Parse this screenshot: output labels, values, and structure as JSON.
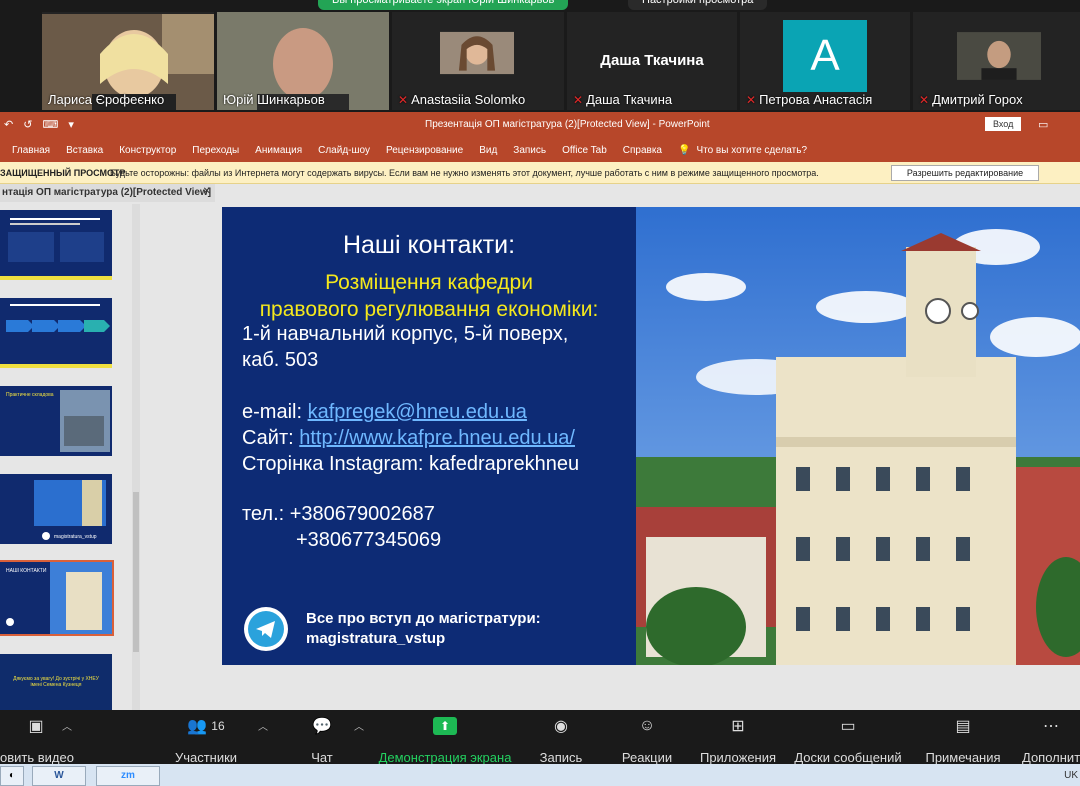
{
  "share_banner": {
    "sharing_label": "Вы просматриваете экран Юрій Шинкарьов",
    "view_options_label": "Настройки просмотра"
  },
  "participants": [
    {
      "name": "Лариса Єрофеєнко",
      "muted": false,
      "active": false
    },
    {
      "name": "Юрій Шинкарьов",
      "muted": false,
      "active": true
    },
    {
      "name": "Anastasiia Solomko",
      "muted": true,
      "active": false
    },
    {
      "name": "Даша Ткачина",
      "muted": true,
      "active": false,
      "center_name": "Даша Ткачина"
    },
    {
      "name": "Петрова Анастасія",
      "muted": true,
      "active": false,
      "avatar_letter": "A"
    },
    {
      "name": "Дмитрий Горох",
      "muted": true,
      "active": false
    }
  ],
  "ppt": {
    "qat_symbols": [
      "↶",
      "↺",
      "⌨",
      "▾"
    ],
    "window_title": "Презентація  ОП магістратура (2)[Protected View]  -  PowerPoint",
    "login_button": "Вход",
    "menu": [
      "Главная",
      "Вставка",
      "Конструктор",
      "Переходы",
      "Анимация",
      "Слайд-шоу",
      "Рецензирование",
      "Вид",
      "Запись",
      "Office Tab",
      "Справка"
    ],
    "tell_me": "Что вы хотите сделать?",
    "protected_title": "ЗАЩИЩЕННЫЙ ПРОСМОТР",
    "protected_text": "Будьте осторожны: файлы из Интернета могут содержать вирусы. Если вам не нужно изменять этот документ, лучше работать с ним в режиме защищенного просмотра.",
    "enable_editing": "Разрешить редактирование",
    "doc_tab": "нтація  ОП магістратура (2)[Protected View]",
    "thumb5_text": "НАШІ КОНТАКТИ",
    "thumb3_text": "Практичне складова",
    "thumb4_text": "magistratura_vstup",
    "thumb6_text": "Дякуємо за увагу! До зустрічі у ХНЕУ імені Семена Кузнеця"
  },
  "slide": {
    "title": "Наші контакти:",
    "yellow_line1": "Розміщення кафедри",
    "yellow_line2": "правового регулювання економіки:",
    "addr_line1": "1-й  навчальний корпус, 5-й поверх,",
    "addr_line2": "каб. 503",
    "email_label": "e-mail: ",
    "email": "kafpregek@hneu.edu.ua",
    "site_label": "Сайт: ",
    "site": "http://www.kafpre.hneu.edu.ua/",
    "instagram": "Сторінка Instagram: kafedraprekhneu",
    "phone1": "тел.: +380679002687",
    "phone2": "+380677345069",
    "tg_line1": "Все про вступ до магістратури:",
    "tg_line2": "magistratura_vstup"
  },
  "toolbar": {
    "video": "овить видео",
    "participants": "Участники",
    "participants_count": "16",
    "chat": "Чат",
    "share": "Демонстрация экрана",
    "record": "Запись",
    "reactions": "Реакции",
    "apps": "Приложения",
    "whiteboards": "Доски сообщений",
    "notes": "Примечания",
    "more": "Дополнит"
  },
  "taskbar": {
    "zoom_label": "zm",
    "lang": "UK"
  }
}
